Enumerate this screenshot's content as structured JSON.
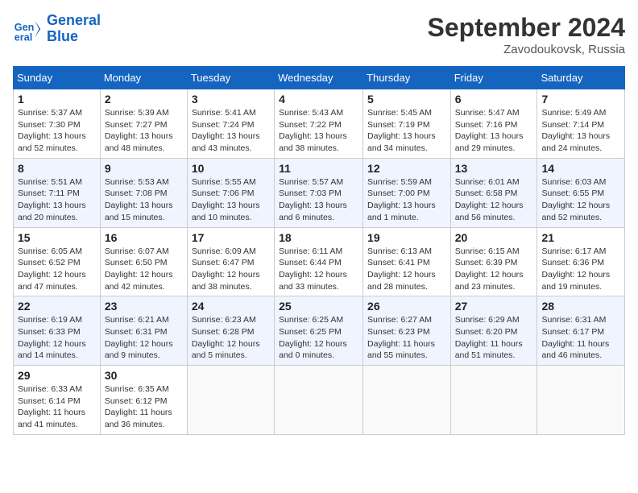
{
  "header": {
    "logo_line1": "General",
    "logo_line2": "Blue",
    "month_title": "September 2024",
    "location": "Zavodoukovsk, Russia"
  },
  "weekdays": [
    "Sunday",
    "Monday",
    "Tuesday",
    "Wednesday",
    "Thursday",
    "Friday",
    "Saturday"
  ],
  "weeks": [
    [
      {
        "day": "1",
        "sunrise": "5:37 AM",
        "sunset": "7:30 PM",
        "daylight": "13 hours and 52 minutes."
      },
      {
        "day": "2",
        "sunrise": "5:39 AM",
        "sunset": "7:27 PM",
        "daylight": "13 hours and 48 minutes."
      },
      {
        "day": "3",
        "sunrise": "5:41 AM",
        "sunset": "7:24 PM",
        "daylight": "13 hours and 43 minutes."
      },
      {
        "day": "4",
        "sunrise": "5:43 AM",
        "sunset": "7:22 PM",
        "daylight": "13 hours and 38 minutes."
      },
      {
        "day": "5",
        "sunrise": "5:45 AM",
        "sunset": "7:19 PM",
        "daylight": "13 hours and 34 minutes."
      },
      {
        "day": "6",
        "sunrise": "5:47 AM",
        "sunset": "7:16 PM",
        "daylight": "13 hours and 29 minutes."
      },
      {
        "day": "7",
        "sunrise": "5:49 AM",
        "sunset": "7:14 PM",
        "daylight": "13 hours and 24 minutes."
      }
    ],
    [
      {
        "day": "8",
        "sunrise": "5:51 AM",
        "sunset": "7:11 PM",
        "daylight": "13 hours and 20 minutes."
      },
      {
        "day": "9",
        "sunrise": "5:53 AM",
        "sunset": "7:08 PM",
        "daylight": "13 hours and 15 minutes."
      },
      {
        "day": "10",
        "sunrise": "5:55 AM",
        "sunset": "7:06 PM",
        "daylight": "13 hours and 10 minutes."
      },
      {
        "day": "11",
        "sunrise": "5:57 AM",
        "sunset": "7:03 PM",
        "daylight": "13 hours and 6 minutes."
      },
      {
        "day": "12",
        "sunrise": "5:59 AM",
        "sunset": "7:00 PM",
        "daylight": "13 hours and 1 minute."
      },
      {
        "day": "13",
        "sunrise": "6:01 AM",
        "sunset": "6:58 PM",
        "daylight": "12 hours and 56 minutes."
      },
      {
        "day": "14",
        "sunrise": "6:03 AM",
        "sunset": "6:55 PM",
        "daylight": "12 hours and 52 minutes."
      }
    ],
    [
      {
        "day": "15",
        "sunrise": "6:05 AM",
        "sunset": "6:52 PM",
        "daylight": "12 hours and 47 minutes."
      },
      {
        "day": "16",
        "sunrise": "6:07 AM",
        "sunset": "6:50 PM",
        "daylight": "12 hours and 42 minutes."
      },
      {
        "day": "17",
        "sunrise": "6:09 AM",
        "sunset": "6:47 PM",
        "daylight": "12 hours and 38 minutes."
      },
      {
        "day": "18",
        "sunrise": "6:11 AM",
        "sunset": "6:44 PM",
        "daylight": "12 hours and 33 minutes."
      },
      {
        "day": "19",
        "sunrise": "6:13 AM",
        "sunset": "6:41 PM",
        "daylight": "12 hours and 28 minutes."
      },
      {
        "day": "20",
        "sunrise": "6:15 AM",
        "sunset": "6:39 PM",
        "daylight": "12 hours and 23 minutes."
      },
      {
        "day": "21",
        "sunrise": "6:17 AM",
        "sunset": "6:36 PM",
        "daylight": "12 hours and 19 minutes."
      }
    ],
    [
      {
        "day": "22",
        "sunrise": "6:19 AM",
        "sunset": "6:33 PM",
        "daylight": "12 hours and 14 minutes."
      },
      {
        "day": "23",
        "sunrise": "6:21 AM",
        "sunset": "6:31 PM",
        "daylight": "12 hours and 9 minutes."
      },
      {
        "day": "24",
        "sunrise": "6:23 AM",
        "sunset": "6:28 PM",
        "daylight": "12 hours and 5 minutes."
      },
      {
        "day": "25",
        "sunrise": "6:25 AM",
        "sunset": "6:25 PM",
        "daylight": "12 hours and 0 minutes."
      },
      {
        "day": "26",
        "sunrise": "6:27 AM",
        "sunset": "6:23 PM",
        "daylight": "11 hours and 55 minutes."
      },
      {
        "day": "27",
        "sunrise": "6:29 AM",
        "sunset": "6:20 PM",
        "daylight": "11 hours and 51 minutes."
      },
      {
        "day": "28",
        "sunrise": "6:31 AM",
        "sunset": "6:17 PM",
        "daylight": "11 hours and 46 minutes."
      }
    ],
    [
      {
        "day": "29",
        "sunrise": "6:33 AM",
        "sunset": "6:14 PM",
        "daylight": "11 hours and 41 minutes."
      },
      {
        "day": "30",
        "sunrise": "6:35 AM",
        "sunset": "6:12 PM",
        "daylight": "11 hours and 36 minutes."
      },
      null,
      null,
      null,
      null,
      null
    ]
  ],
  "labels": {
    "sunrise": "Sunrise:",
    "sunset": "Sunset:",
    "daylight": "Daylight:"
  }
}
